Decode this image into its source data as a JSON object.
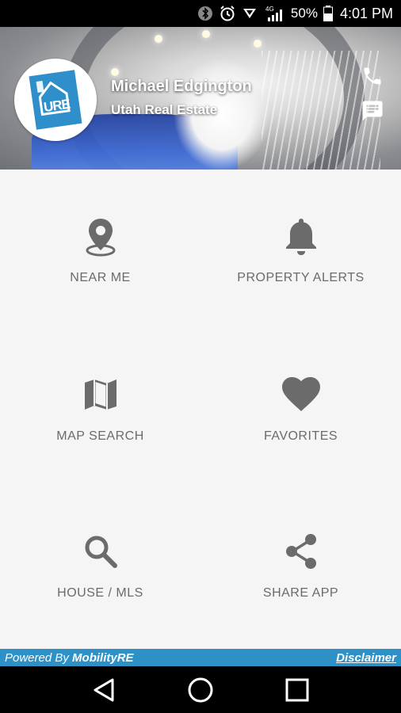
{
  "status_bar": {
    "network_label": "4G",
    "battery": "50%",
    "time": "4:01 PM"
  },
  "header": {
    "agent_name": "Michael Edgington",
    "company": "Utah Real Estate",
    "logo_text": "URE",
    "icons": {
      "call": "phone-icon",
      "message": "message-icon"
    }
  },
  "menu": {
    "near_me": "NEAR ME",
    "property_alerts": "PROPERTY ALERTS",
    "map_search": "MAP SEARCH",
    "favorites": "FAVORITES",
    "house_mls": "HOUSE / MLS",
    "share_app": "SHARE APP"
  },
  "footer": {
    "powered_prefix": "Powered By",
    "powered_brand": "MobilityRE",
    "disclaimer": "Disclaimer"
  },
  "colors": {
    "icon_gray": "#6b6b6b",
    "footer_blue": "#2d90c7",
    "logo_blue": "#2e8fcb",
    "grid_bg": "#f5f5f5"
  }
}
